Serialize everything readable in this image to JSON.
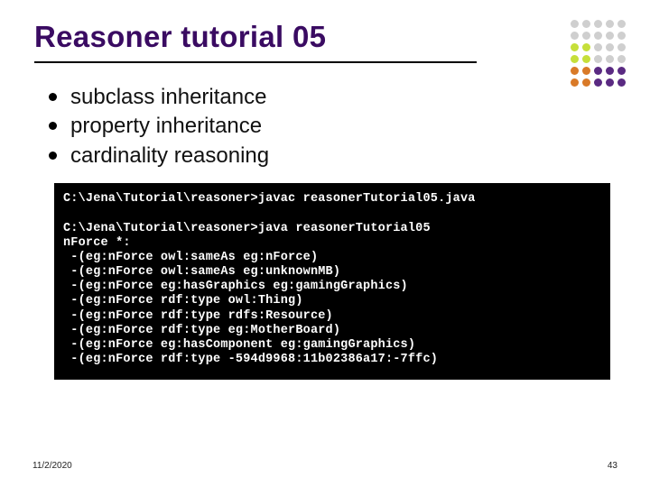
{
  "title": "Reasoner tutorial 05",
  "bullets": [
    "subclass inheritance",
    "property inheritance",
    "cardinality reasoning"
  ],
  "terminal_lines": [
    "C:\\Jena\\Tutorial\\reasoner>javac reasonerTutorial05.java",
    "",
    "C:\\Jena\\Tutorial\\reasoner>java reasonerTutorial05",
    "nForce *:",
    " -(eg:nForce owl:sameAs eg:nForce)",
    " -(eg:nForce owl:sameAs eg:unknownMB)",
    " -(eg:nForce eg:hasGraphics eg:gamingGraphics)",
    " -(eg:nForce rdf:type owl:Thing)",
    " -(eg:nForce rdf:type rdfs:Resource)",
    " -(eg:nForce rdf:type eg:MotherBoard)",
    " -(eg:nForce eg:hasComponent eg:gamingGraphics)",
    " -(eg:nForce rdf:type -594d9968:11b02386a17:-7ffc)"
  ],
  "footer_date": "11/2/2020",
  "footer_page": "43",
  "deco_colors": [
    "#cfcfcf",
    "#cfcfcf",
    "#cfcfcf",
    "#cfcfcf",
    "#cfcfcf",
    "#cfcfcf",
    "#cfcfcf",
    "#cfcfcf",
    "#cfcfcf",
    "#cfcfcf",
    "#c6df3a",
    "#c6df3a",
    "#cfcfcf",
    "#cfcfcf",
    "#cfcfcf",
    "#c6df3a",
    "#c6df3a",
    "#cfcfcf",
    "#cfcfcf",
    "#cfcfcf",
    "#d97a28",
    "#d97a28",
    "#5a2a82",
    "#5a2a82",
    "#5a2a82",
    "#d97a28",
    "#d97a28",
    "#5a2a82",
    "#5a2a82",
    "#5a2a82"
  ]
}
